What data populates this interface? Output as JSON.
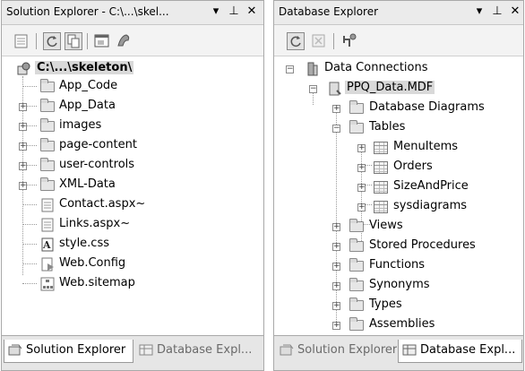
{
  "solution_explorer": {
    "title": "Solution Explorer - C:\\...\\skel...",
    "window_buttons": {
      "dropdown": "▾",
      "pin": "⊥",
      "close": "✕"
    },
    "root": "C:\\...\\skeleton\\",
    "items": [
      {
        "label": "App_Code",
        "icon": "special-folder-icon"
      },
      {
        "label": "App_Data",
        "icon": "special-folder-icon"
      },
      {
        "label": "images",
        "icon": "folder-icon"
      },
      {
        "label": "page-content",
        "icon": "folder-icon"
      },
      {
        "label": "user-controls",
        "icon": "folder-icon"
      },
      {
        "label": "XML-Data",
        "icon": "folder-icon"
      },
      {
        "label": "Contact.aspx~",
        "icon": "aspx-file-icon"
      },
      {
        "label": "Links.aspx~",
        "icon": "aspx-file-icon"
      },
      {
        "label": "style.css",
        "icon": "css-file-icon"
      },
      {
        "label": "Web.Config",
        "icon": "config-file-icon"
      },
      {
        "label": "Web.sitemap",
        "icon": "sitemap-file-icon"
      }
    ],
    "tabs": {
      "active": "Solution Explorer",
      "inactive": "Database Expl..."
    }
  },
  "database_explorer": {
    "title": "Database Explorer",
    "window_buttons": {
      "dropdown": "▾",
      "pin": "⊥",
      "close": "✕"
    },
    "root": "Data Connections",
    "connection": "PPQ_Data.MDF",
    "nodes": [
      {
        "label": "Database Diagrams"
      },
      {
        "label": "Tables"
      },
      {
        "label": "MenuItems"
      },
      {
        "label": "Orders"
      },
      {
        "label": "SizeAndPrice"
      },
      {
        "label": "sysdiagrams"
      },
      {
        "label": "Views"
      },
      {
        "label": "Stored Procedures"
      },
      {
        "label": "Functions"
      },
      {
        "label": "Synonyms"
      },
      {
        "label": "Types"
      },
      {
        "label": "Assemblies"
      }
    ],
    "tabs": {
      "inactive": "Solution Explorer",
      "active": "Database Expl..."
    }
  }
}
